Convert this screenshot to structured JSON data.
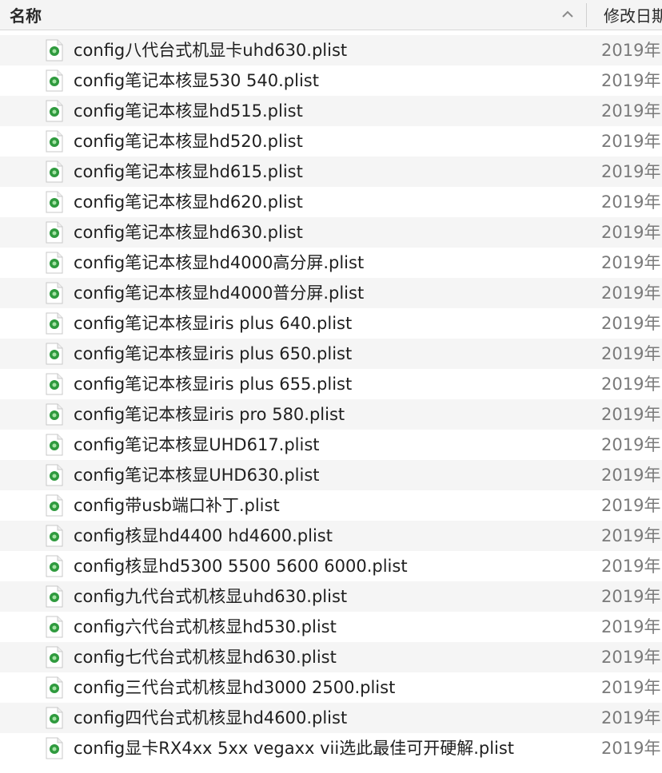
{
  "header": {
    "name_label": "名称",
    "date_label": "修改日期"
  },
  "files": [
    {
      "name": "config八代台式机显卡uhd630.plist",
      "date": "2019年"
    },
    {
      "name": "config笔记本核显530 540.plist",
      "date": "2019年"
    },
    {
      "name": "config笔记本核显hd515.plist",
      "date": "2019年"
    },
    {
      "name": "config笔记本核显hd520.plist",
      "date": "2019年"
    },
    {
      "name": "config笔记本核显hd615.plist",
      "date": "2019年"
    },
    {
      "name": "config笔记本核显hd620.plist",
      "date": "2019年"
    },
    {
      "name": "config笔记本核显hd630.plist",
      "date": "2019年"
    },
    {
      "name": "config笔记本核显hd4000高分屏.plist",
      "date": "2019年"
    },
    {
      "name": "config笔记本核显hd4000普分屏.plist",
      "date": "2019年"
    },
    {
      "name": "config笔记本核显iris plus 640.plist",
      "date": "2019年"
    },
    {
      "name": "config笔记本核显iris plus 650.plist",
      "date": "2019年"
    },
    {
      "name": "config笔记本核显iris plus 655.plist",
      "date": "2019年"
    },
    {
      "name": "config笔记本核显iris pro 580.plist",
      "date": "2019年"
    },
    {
      "name": "config笔记本核显UHD617.plist",
      "date": "2019年"
    },
    {
      "name": "config笔记本核显UHD630.plist",
      "date": "2019年"
    },
    {
      "name": "config带usb端口补丁.plist",
      "date": "2019年"
    },
    {
      "name": "config核显hd4400 hd4600.plist",
      "date": "2019年"
    },
    {
      "name": "config核显hd5300 5500 5600 6000.plist",
      "date": "2019年"
    },
    {
      "name": "config九代台式机核显uhd630.plist",
      "date": "2019年"
    },
    {
      "name": "config六代台式机核显hd530.plist",
      "date": "2019年"
    },
    {
      "name": "config七代台式机核显hd630.plist",
      "date": "2019年"
    },
    {
      "name": "config三代台式机核显hd3000 2500.plist",
      "date": "2019年"
    },
    {
      "name": "config四代台式机核显hd4600.plist",
      "date": "2019年"
    },
    {
      "name": "config显卡RX4xx 5xx vegaxx vii选此最佳可开硬解.plist",
      "date": "2019年"
    }
  ]
}
